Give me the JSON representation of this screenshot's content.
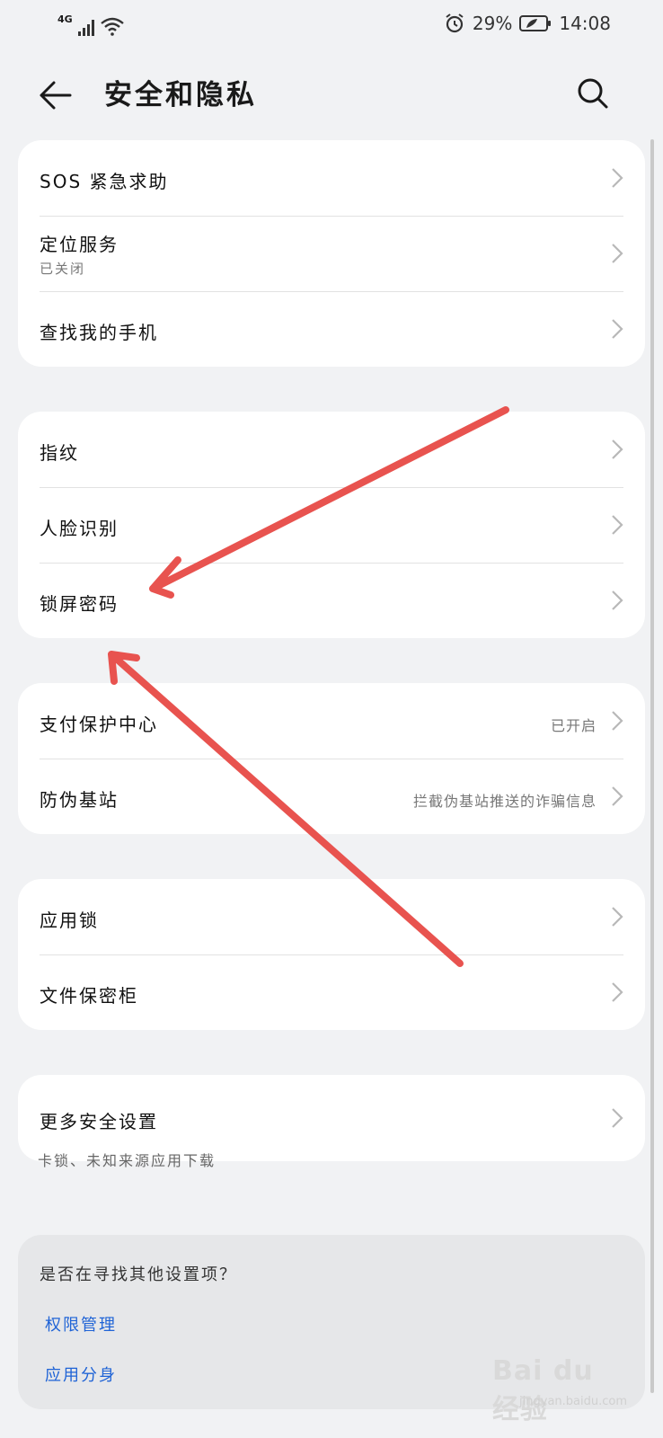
{
  "status_bar": {
    "network": "4G",
    "battery": "29%",
    "time": "14:08"
  },
  "header": {
    "title": "安全和隐私"
  },
  "groups": [
    [
      {
        "label": "SOS 紧急求助"
      },
      {
        "label": "定位服务",
        "sub": "已关闭"
      },
      {
        "label": "查找我的手机"
      }
    ],
    [
      {
        "label": "指纹"
      },
      {
        "label": "人脸识别"
      },
      {
        "label": "锁屏密码"
      }
    ],
    [
      {
        "label": "支付保护中心",
        "value": "已开启"
      },
      {
        "label": "防伪基站",
        "value": "拦截伪基站推送的诈骗信息"
      }
    ],
    [
      {
        "label": "应用锁"
      },
      {
        "label": "文件保密柜"
      }
    ],
    [
      {
        "label": "更多安全设置"
      }
    ]
  ],
  "hint": "卡锁、未知来源应用下载",
  "suggestions": {
    "question": "是否在寻找其他设置项？",
    "links": [
      "权限管理",
      "应用分身"
    ]
  },
  "watermark": {
    "brand": "Bai du 经验",
    "url": "jingyan.baidu.com"
  },
  "colors": {
    "background": "#f1f2f4",
    "card": "#ffffff",
    "link": "#1f63d6",
    "annotation_arrow": "#e8534f"
  }
}
